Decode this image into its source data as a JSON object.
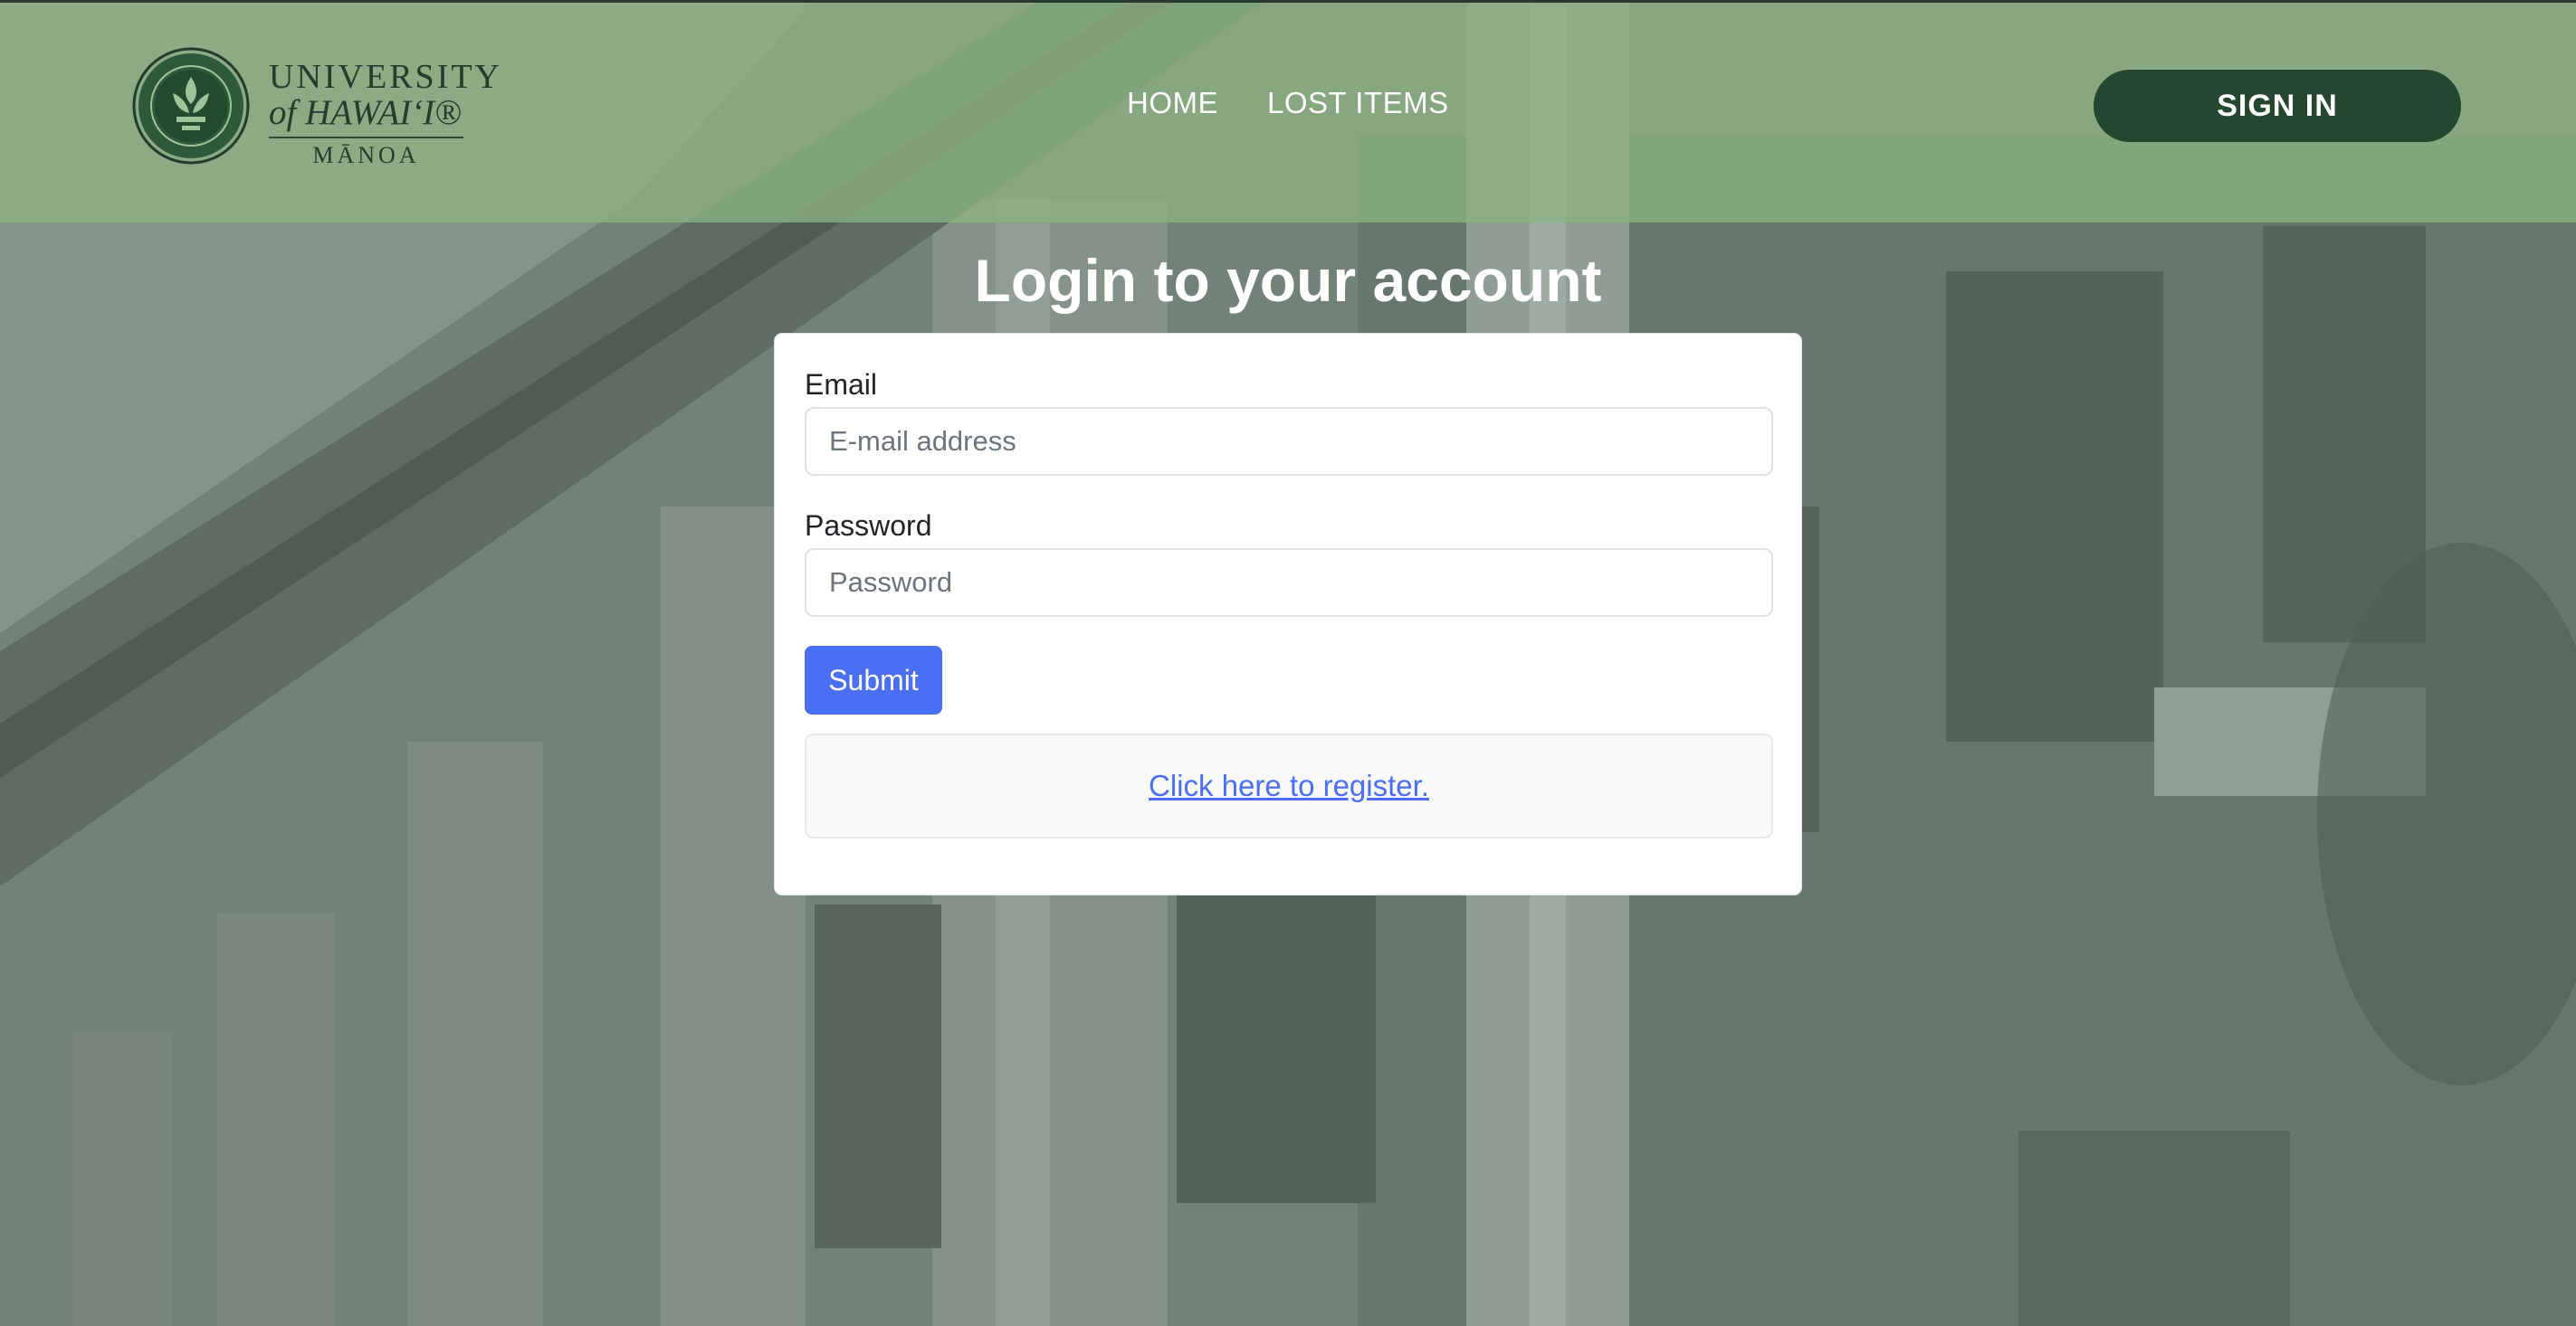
{
  "navbar": {
    "logo": {
      "line1": "UNIVERSITY",
      "line2": "of HAWAI‘I®",
      "line3": "MĀNOA"
    },
    "links": [
      "HOME",
      "LOST ITEMS"
    ],
    "signin_label": "SIGN IN"
  },
  "login": {
    "title": "Login to your account",
    "email_label": "Email",
    "email_placeholder": "E-mail address",
    "email_value": "",
    "password_label": "Password",
    "password_placeholder": "Password",
    "password_value": "",
    "submit_label": "Submit",
    "register_link": "Click here to register."
  },
  "colors": {
    "navbar_bg": "#8cb282",
    "signin_bg": "#26472f",
    "submit_bg": "#4a6ff2",
    "link": "#4a6ff2",
    "page_bg": "#6f7d74"
  },
  "icons": {
    "logo_seal": "university-seal-icon"
  }
}
